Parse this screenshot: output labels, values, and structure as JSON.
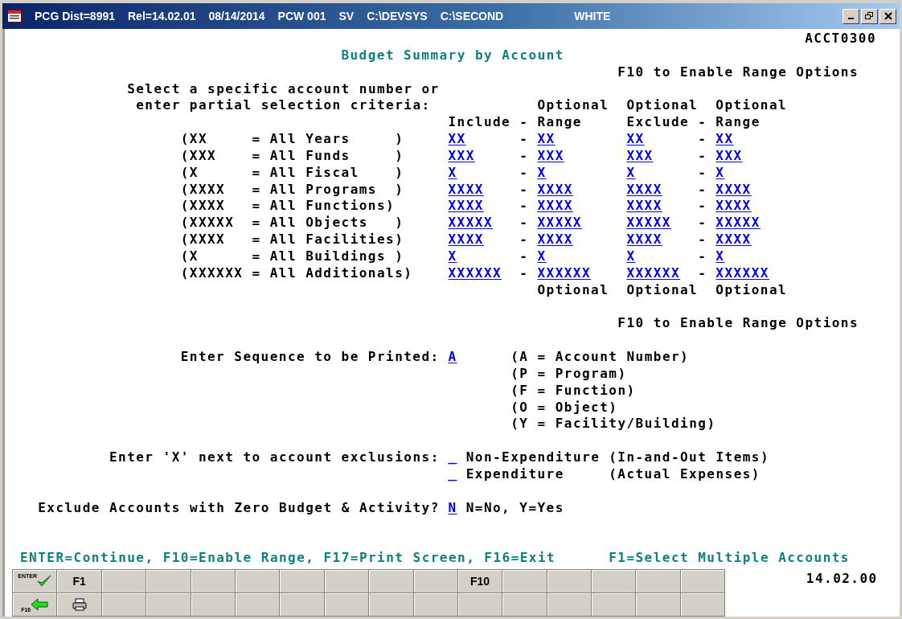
{
  "window": {
    "title_parts": [
      "PCG Dist=8991",
      "Rel=14.02.01",
      "08/14/2014",
      "PCW 001",
      "SV",
      "C:\\DEVSYS",
      "C:\\SECOND",
      "WHITE"
    ]
  },
  "screen_id": "ACCT0300",
  "title": "Budget Summary by Account",
  "range_hint_top": "F10 to Enable Range Options",
  "instructions": [
    "Select a specific account number or",
    "enter partial selection criteria:"
  ],
  "headers": {
    "optional_top": [
      "Optional",
      "Optional",
      "Optional"
    ],
    "include": "Include",
    "dash_1": "-",
    "range_1": "Range",
    "exclude": "Exclude",
    "dash_2": "-",
    "range_2": "Range"
  },
  "criteria": [
    {
      "legend": "(XX     = All Years     )",
      "include": "XX",
      "dash_1": "-",
      "include_range": "XX",
      "exclude": "XX",
      "dash_2": "-",
      "exclude_range": "XX"
    },
    {
      "legend": "(XXX    = All Funds     )",
      "include": "XXX",
      "dash_1": "-",
      "include_range": "XXX",
      "exclude": "XXX",
      "dash_2": "-",
      "exclude_range": "XXX"
    },
    {
      "legend": "(X      = All Fiscal    )",
      "include": "X",
      "dash_1": "-",
      "include_range": "X",
      "exclude": "X",
      "dash_2": "-",
      "exclude_range": "X"
    },
    {
      "legend": "(XXXX   = All Programs  )",
      "include": "XXXX",
      "dash_1": "-",
      "include_range": "XXXX",
      "exclude": "XXXX",
      "dash_2": "-",
      "exclude_range": "XXXX"
    },
    {
      "legend": "(XXXX   = All Functions)",
      "include": "XXXX",
      "dash_1": "-",
      "include_range": "XXXX",
      "exclude": "XXXX",
      "dash_2": "-",
      "exclude_range": "XXXX"
    },
    {
      "legend": "(XXXXX  = All Objects   )",
      "include": "XXXXX",
      "dash_1": "-",
      "include_range": "XXXXX",
      "exclude": "XXXXX",
      "dash_2": "-",
      "exclude_range": "XXXXX"
    },
    {
      "legend": "(XXXX   = All Facilities)",
      "include": "XXXX",
      "dash_1": "-",
      "include_range": "XXXX",
      "exclude": "XXXX",
      "dash_2": "-",
      "exclude_range": "XXXX"
    },
    {
      "legend": "(X      = All Buildings )",
      "include": "X",
      "dash_1": "-",
      "include_range": "X",
      "exclude": "X",
      "dash_2": "-",
      "exclude_range": "X"
    },
    {
      "legend": "(XXXXXX = All Additionals)",
      "include": "XXXXXX",
      "dash_1": "-",
      "include_range": "XXXXXX",
      "exclude": "XXXXXX",
      "dash_2": "-",
      "exclude_range": "XXXXXX"
    }
  ],
  "optional_bottom": [
    "Optional",
    "Optional",
    "Optional"
  ],
  "range_hint_bottom": "F10 to Enable Range Options",
  "sequence": {
    "label": "Enter Sequence to be Printed:",
    "value": "A",
    "options": [
      "(A = Account Number)",
      "(P = Program)",
      "(F = Function)",
      "(O = Object)",
      "(Y = Facility/Building)"
    ]
  },
  "exclusions": {
    "label": "Enter 'X' next to account exclusions:",
    "items": [
      {
        "value": "_",
        "name": "Non-Expenditure",
        "note": "(In-and-Out Items)"
      },
      {
        "value": "_",
        "name": "Expenditure",
        "note": "(Actual Expenses)"
      }
    ]
  },
  "zero_budget": {
    "label": "Exclude Accounts with Zero Budget & Activity?",
    "value": "N",
    "hint": "N=No, Y=Yes"
  },
  "command_line": {
    "left": "ENTER=Continue, F10=Enable Range, F17=Print Screen, F16=Exit",
    "right": "F1=Select Multiple Accounts"
  },
  "version": "14.02.00",
  "function_keys": [
    [
      {
        "kind": "enter",
        "label": "ENTER"
      },
      {
        "kind": "key",
        "label": "F1"
      },
      {
        "kind": "blank"
      },
      {
        "kind": "blank"
      },
      {
        "kind": "blank"
      },
      {
        "kind": "blank"
      },
      {
        "kind": "blank"
      },
      {
        "kind": "blank"
      },
      {
        "kind": "blank"
      },
      {
        "kind": "blank"
      },
      {
        "kind": "key",
        "label": "F10"
      },
      {
        "kind": "blank"
      },
      {
        "kind": "blank"
      },
      {
        "kind": "blank"
      },
      {
        "kind": "blank"
      },
      {
        "kind": "blank"
      }
    ],
    [
      {
        "kind": "exit",
        "label": "F16"
      },
      {
        "kind": "print"
      },
      {
        "kind": "blank"
      },
      {
        "kind": "blank"
      },
      {
        "kind": "blank"
      },
      {
        "kind": "blank"
      },
      {
        "kind": "blank"
      },
      {
        "kind": "blank"
      },
      {
        "kind": "blank"
      },
      {
        "kind": "blank"
      },
      {
        "kind": "blank"
      },
      {
        "kind": "blank"
      },
      {
        "kind": "blank"
      },
      {
        "kind": "blank"
      },
      {
        "kind": "blank"
      },
      {
        "kind": "blank"
      }
    ]
  ]
}
